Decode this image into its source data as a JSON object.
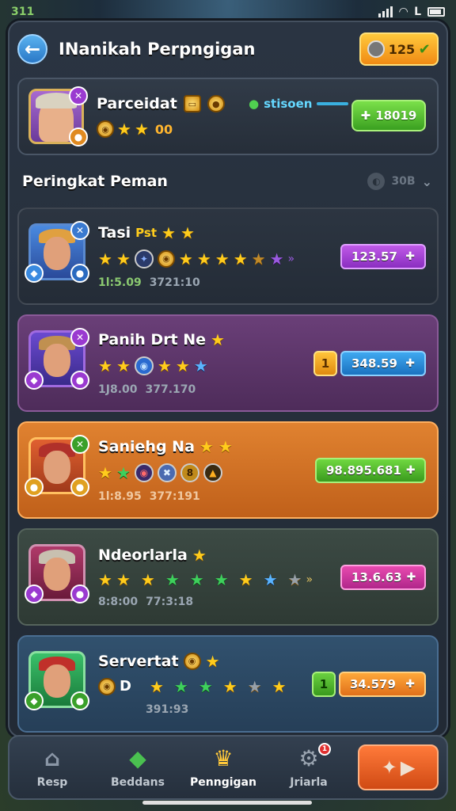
{
  "status_bar": {
    "left_text": "311",
    "right_text": "L"
  },
  "header": {
    "title": "INanikah Perpngigan",
    "currency_value": "125",
    "back_icon": "arrow-left-icon"
  },
  "player": {
    "name": "Parceidat",
    "level": "00",
    "stars": 2,
    "status_text": "stisoen",
    "button_value": "18019"
  },
  "section": {
    "title": "Peringkat Peman",
    "filter_value": "30B"
  },
  "rankings": [
    {
      "name": "Tasi",
      "tag": "Pst",
      "meta1": "1l:5.09",
      "meta2": "3721:10",
      "score": "123.57",
      "score_color": "purple",
      "chip": ""
    },
    {
      "name": "Panih Drt Ne",
      "tag": "",
      "meta1": "1J8.00",
      "meta2": "377.170",
      "score": "348.59",
      "score_color": "blue",
      "chip": "1"
    },
    {
      "name": "Saniehg Na",
      "tag": "",
      "meta1": "1l:8.95",
      "meta2": "377:191",
      "score": "98.895.681",
      "score_color": "green",
      "chip": ""
    },
    {
      "name": "Ndeorlarla",
      "tag": "",
      "meta1": "8:8:00",
      "meta2": "77:3:18",
      "score": "13.6.63",
      "score_color": "pink",
      "chip": ""
    },
    {
      "name": "Servertat",
      "tag": "",
      "meta1": "",
      "meta2": "391:93",
      "score": "34.579",
      "score_color": "orange",
      "chip": "1"
    }
  ],
  "nav": [
    {
      "label": "Resp",
      "icon": "home-icon"
    },
    {
      "label": "Beddans",
      "icon": "cube-icon"
    },
    {
      "label": "Penngigan",
      "icon": "crown-icon"
    },
    {
      "label": "Jriarla",
      "icon": "settings-icon",
      "badge": "1"
    }
  ],
  "play_button": {
    "icon": "play-icon"
  }
}
